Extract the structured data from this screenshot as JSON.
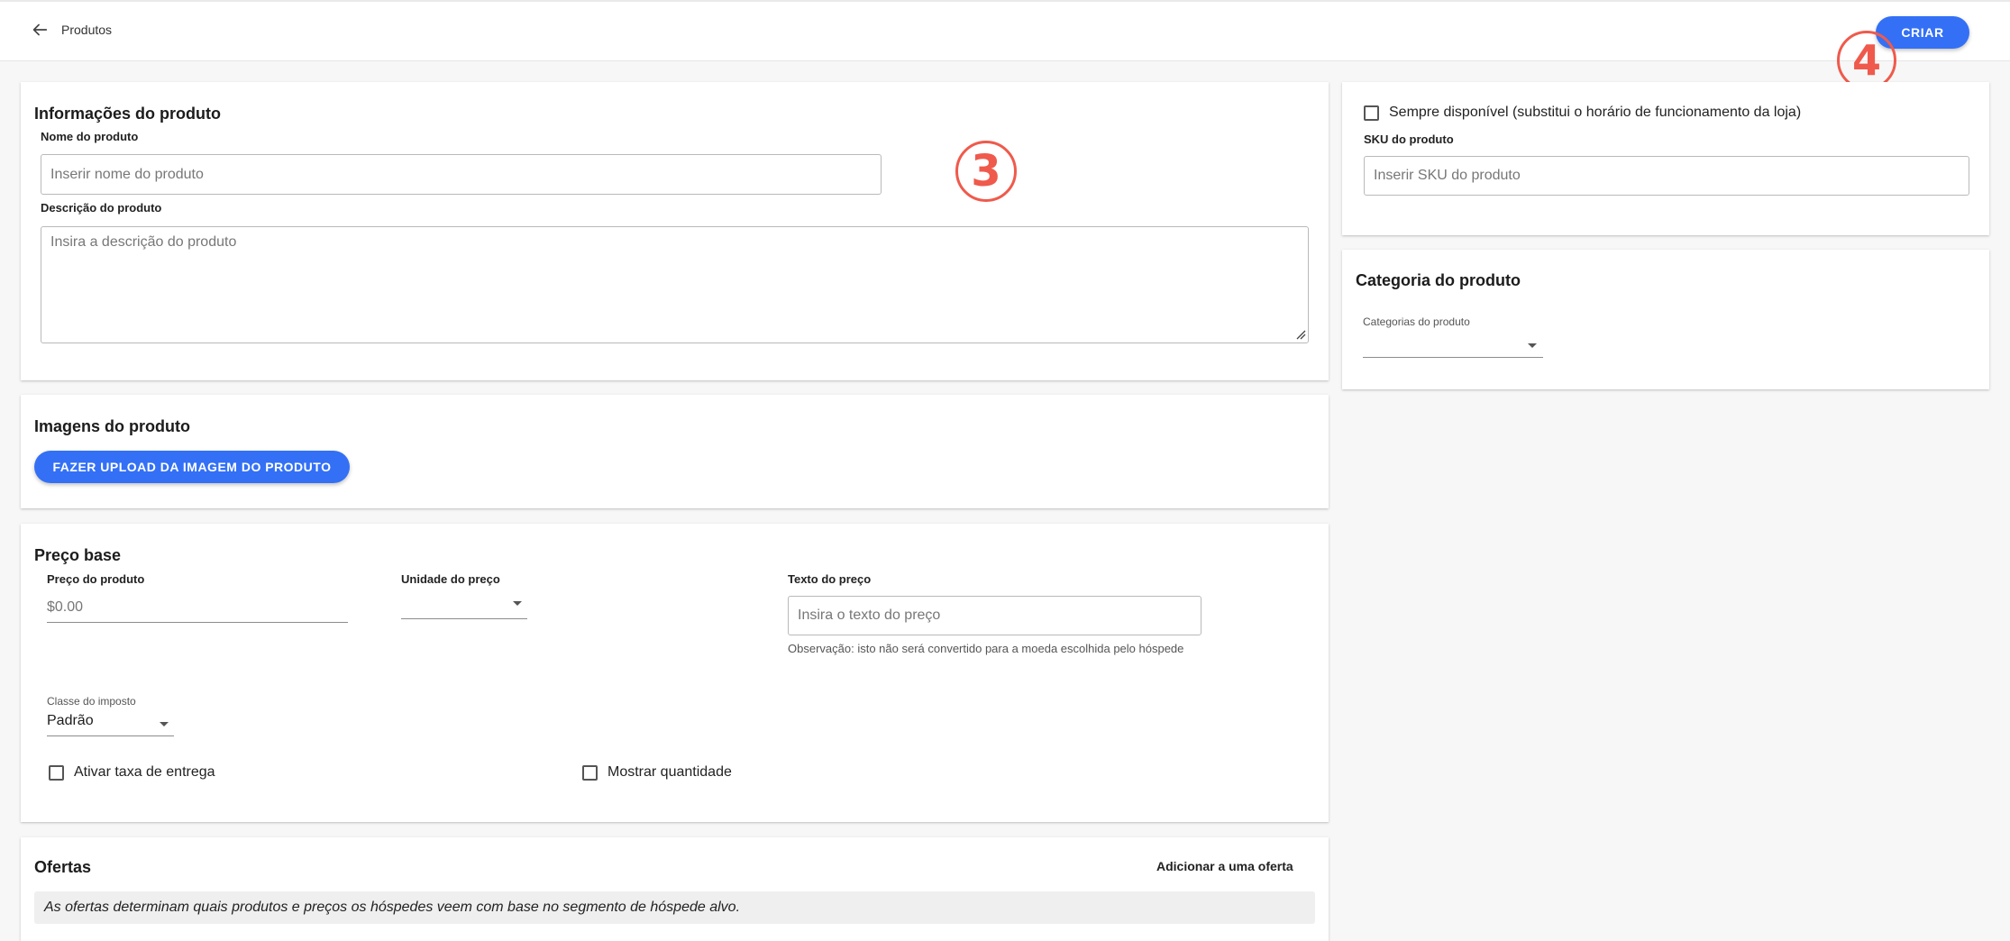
{
  "header": {
    "breadcrumb": "Produtos",
    "create_label": "CRIAR"
  },
  "annotations": {
    "badge_3": "3",
    "badge_4": "4",
    "color": "#ef5a4c"
  },
  "product_info": {
    "title": "Informações do produto",
    "name_label": "Nome do produto",
    "name_placeholder": "Inserir nome do produto",
    "description_label": "Descrição do produto",
    "description_placeholder": "Insira a descrição do produto"
  },
  "images": {
    "title": "Imagens do produto",
    "upload_label": "FAZER UPLOAD DA IMAGEM DO PRODUTO"
  },
  "base_price": {
    "title": "Preço base",
    "price_label": "Preço do produto",
    "price_placeholder": "$0.00",
    "unit_label": "Unidade do preço",
    "unit_value": "",
    "text_label": "Texto do preço",
    "text_placeholder": "Insira o texto do preço",
    "text_note": "Observação: isto não será convertido para a moeda escolhida pelo hóspede",
    "tax_label": "Classe do imposto",
    "tax_value": "Padrão",
    "delivery_fee_label": "Ativar taxa de entrega",
    "show_quantity_label": "Mostrar quantidade"
  },
  "offers": {
    "title": "Ofertas",
    "add_label": "Adicionar a uma oferta",
    "info": "As ofertas determinam quais produtos e preços os hóspedes veem com base no segmento de hóspede alvo."
  },
  "availability": {
    "always_available_label": "Sempre disponível (substitui o horário de funcionamento da loja)",
    "sku_label": "SKU do produto",
    "sku_placeholder": "Inserir SKU do produto"
  },
  "category": {
    "title": "Categoria do produto",
    "select_label": "Categorias do produto",
    "select_value": ""
  },
  "colors": {
    "primary": "#3370f6"
  }
}
